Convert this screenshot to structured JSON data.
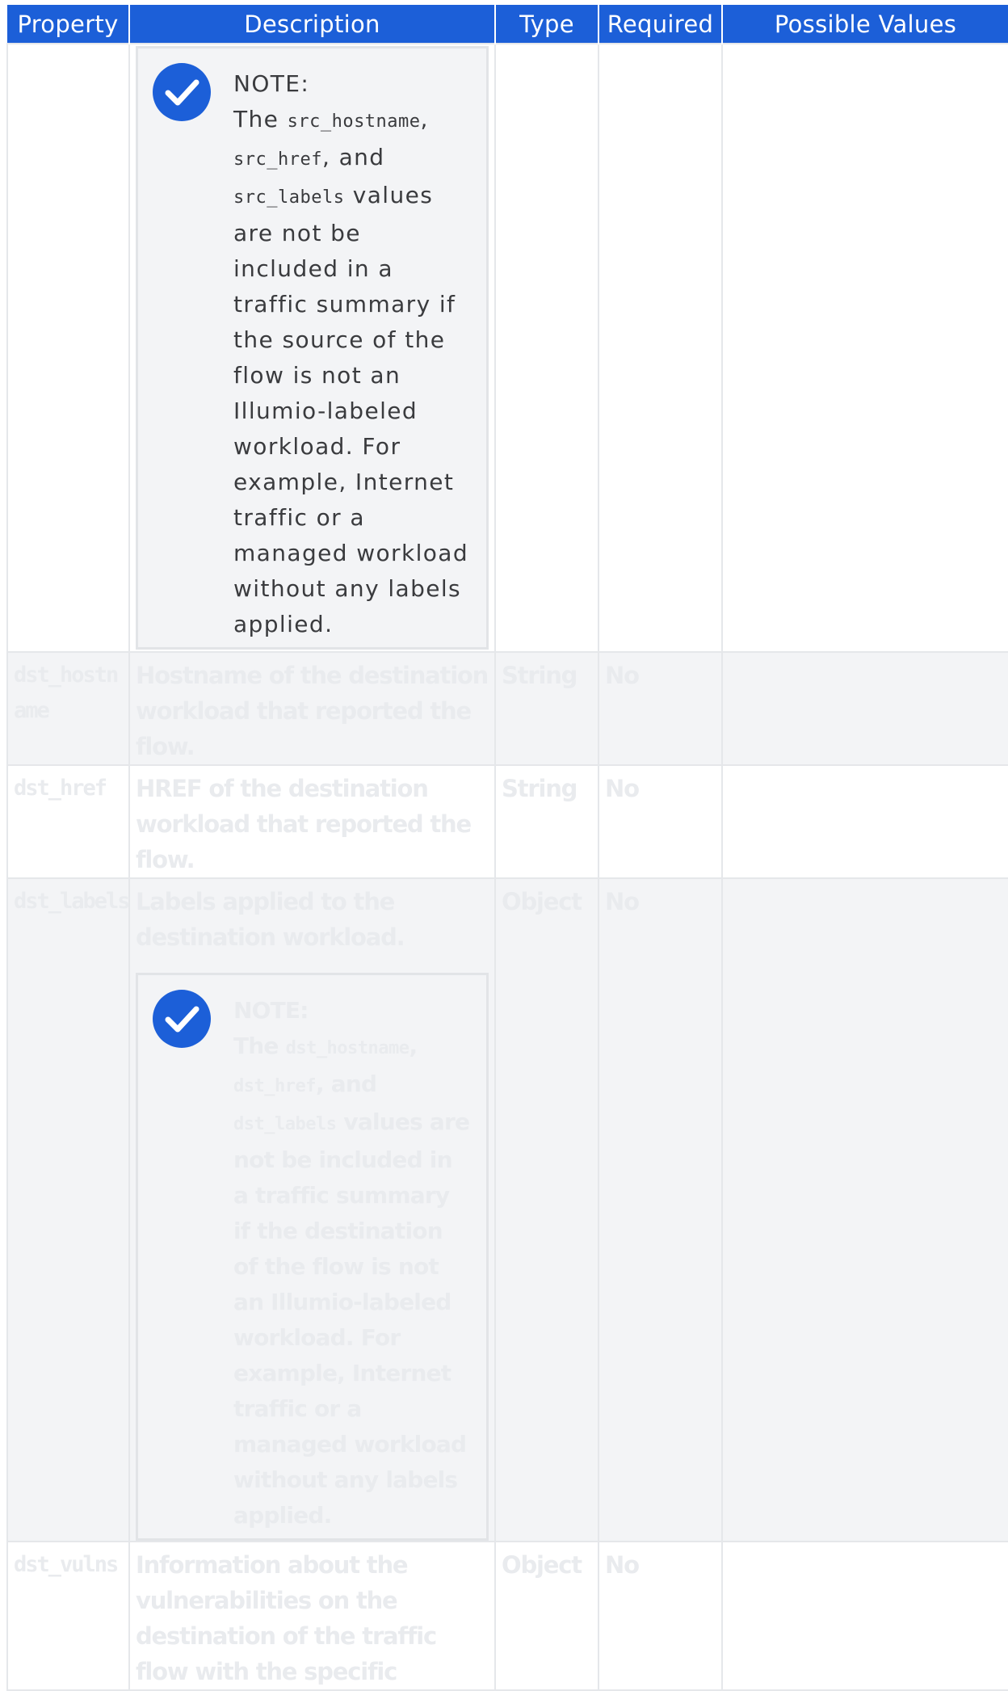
{
  "table": {
    "headers": [
      "Property",
      "Description",
      "Type",
      "Required",
      "Possible Values"
    ]
  },
  "note1": {
    "label": "NOTE:",
    "the": "The",
    "code1": "src_hostname",
    "sep1": ",",
    "code2": "src_href",
    "sep2": ", and",
    "code3": "src_labels",
    "rest": "values are not be included in a traffic summary if the source of the flow is not an Illumio-labeled workload. For example, Internet traffic or a managed workload without any labels applied."
  },
  "rows": {
    "dst_hostname": {
      "property": "dst_hostname",
      "description": "Hostname of the destination workload that reported the flow.",
      "type": "String",
      "required": "No"
    },
    "dst_href": {
      "property": "dst_href",
      "description": "HREF of the destination workload that reported the flow.",
      "type": "String",
      "required": "No"
    },
    "dst_labels": {
      "property": "dst_labels",
      "description": "Labels applied to the destination workload.",
      "type": "Object",
      "required": "No"
    },
    "dst_vulns": {
      "property": "dst_vulns",
      "description": "Information about the vulnerabilities on the destination of the traffic flow with the specific",
      "type": "Object",
      "required": "No"
    }
  },
  "note2": {
    "label": "NOTE:",
    "the": "The",
    "code1": "dst_hostname",
    "sep1": ",",
    "code2": "dst_href",
    "sep2": ", and",
    "code3": "dst_labels",
    "rest": "values are not be included in a traffic summary if the destination of the flow is not an Illumio-labeled workload. For example, Internet traffic or a managed workload without any labels applied."
  },
  "colors": {
    "header_bg": "#1c5fd8",
    "icon_blue": "#1c5fd8",
    "row_shade": "#f3f4f6"
  },
  "icons": [
    "checkmark-circle-icon"
  ]
}
